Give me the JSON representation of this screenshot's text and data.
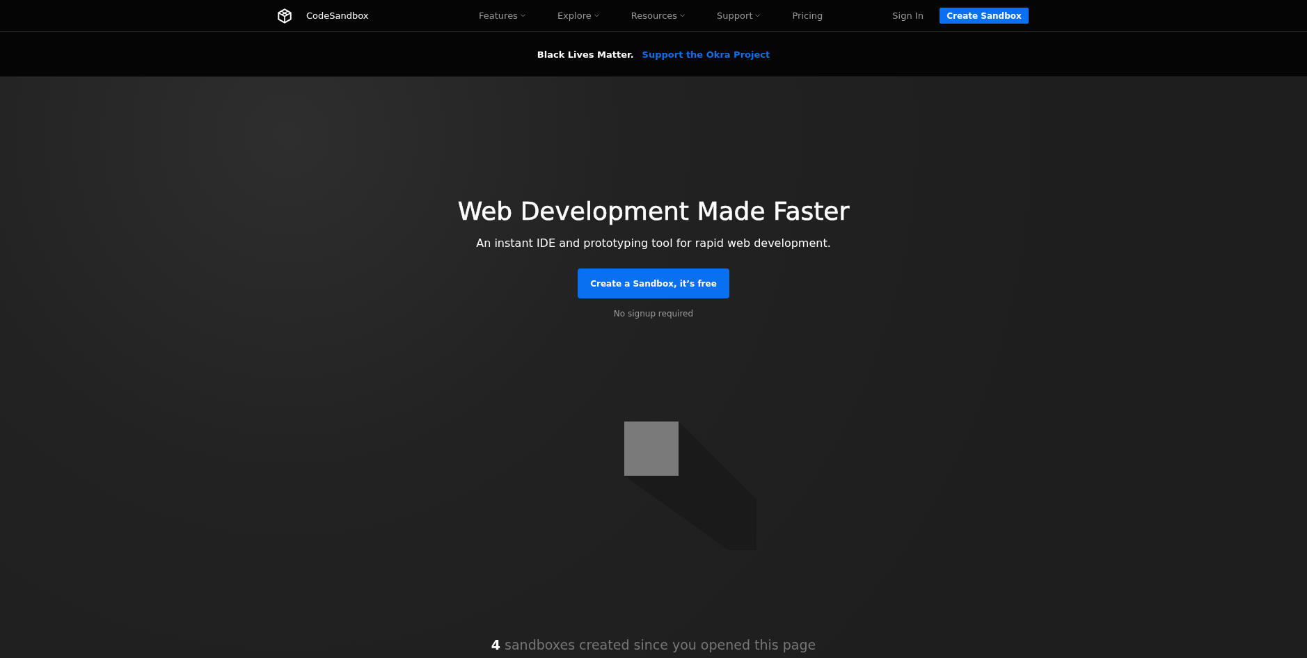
{
  "header": {
    "brand": "CodeSandbox",
    "nav": [
      {
        "label": "Features",
        "has_menu": true
      },
      {
        "label": "Explore",
        "has_menu": true
      },
      {
        "label": "Resources",
        "has_menu": true
      },
      {
        "label": "Support",
        "has_menu": true
      },
      {
        "label": "Pricing",
        "has_menu": false
      }
    ],
    "sign_in": "Sign In",
    "cta": "Create Sandbox"
  },
  "banner": {
    "text": "Black Lives Matter.",
    "link": "Support the Okra Project"
  },
  "hero": {
    "title": "Web Development Made Faster",
    "subtitle": "An instant IDE and prototyping tool for rapid web development.",
    "button": "Create a Sandbox, it’s free",
    "note": "No signup required"
  },
  "counter": "**4** sandboxes created since you opened this page"
}
